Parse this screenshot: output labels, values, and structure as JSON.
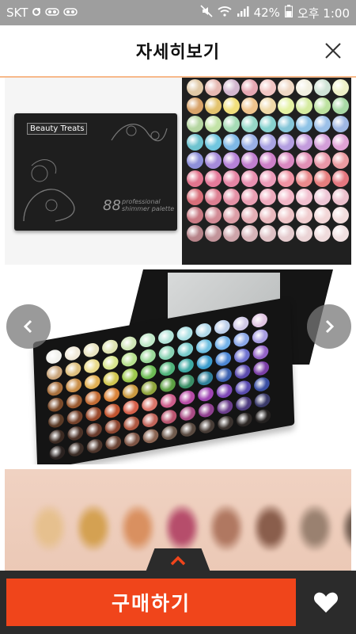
{
  "status_bar": {
    "carrier": "SKT",
    "battery": "42%",
    "time": "오후 1:00"
  },
  "header": {
    "title": "자세히보기"
  },
  "product": {
    "brand": "Beauty Treats",
    "number": "88",
    "subtitle_line1": "professional",
    "subtitle_line2": "shimmer palette"
  },
  "bottom": {
    "buy_label": "구매하기"
  },
  "colors": {
    "accent": "#f0451b",
    "bar": "#2b2b2b"
  },
  "palette_colors": [
    "#e0c9a6",
    "#e6b9b2",
    "#d3b7cf",
    "#e6a7b2",
    "#f1c5c3",
    "#efd8c4",
    "#f2f0e0",
    "#cfe3d6",
    "#eef0c8",
    "#d8a36a",
    "#e3c36e",
    "#f1df7c",
    "#f0c48d",
    "#efd9a8",
    "#e4f2a3",
    "#d5eba0",
    "#bde2a0",
    "#a9d9a6",
    "#b6d6a2",
    "#c3e3a7",
    "#a6dcb6",
    "#95d7c7",
    "#87d2cf",
    "#86c6d8",
    "#8fc3e6",
    "#9cc0e8",
    "#9fb7e2",
    "#6ec3cf",
    "#71c6df",
    "#7fb8e6",
    "#9ab0e6",
    "#a9a3e2",
    "#b39ee0",
    "#c39bdc",
    "#d39ed8",
    "#e0a2d6",
    "#8d8fd9",
    "#a58bd9",
    "#b582d7",
    "#c07fcf",
    "#cd7fc7",
    "#d987c0",
    "#e18fb5",
    "#e897a8",
    "#eb9ca1",
    "#e2758e",
    "#e47a9a",
    "#e585a5",
    "#e890b0",
    "#ec9bb8",
    "#ef93a3",
    "#e98a8c",
    "#e67e7e",
    "#e4777f",
    "#d86f7a",
    "#dd7f92",
    "#e491a6",
    "#ea9fb3",
    "#efaabd",
    "#f2b6c6",
    "#f1c0cf",
    "#eec7d6",
    "#ecc0cc",
    "#c97a84",
    "#d28b96",
    "#db9da6",
    "#e4aeb5",
    "#e9b9be",
    "#eec4c7",
    "#f0cdcf",
    "#f2d6d7",
    "#f3dddd",
    "#b7848a",
    "#c2949a",
    "#cda4aa",
    "#d6b3b8",
    "#dec0c4",
    "#e5cbce",
    "#ebd4d6",
    "#efdbdc",
    "#f1e0e1"
  ],
  "tray_colors": [
    "#f2f2ee",
    "#f0e9d9",
    "#e9e4c1",
    "#dfe3b1",
    "#cfe6b6",
    "#bfe7c7",
    "#b2e3d8",
    "#ace0e4",
    "#b0d8ea",
    "#bdcfe9",
    "#cfc8e6",
    "#e0c5e2",
    "#c9a57a",
    "#dfc07e",
    "#eadb8c",
    "#d8e58e",
    "#b7e08e",
    "#9bd89a",
    "#8ad2b4",
    "#79cacb",
    "#6fbfe0",
    "#74b2e8",
    "#8aa7e7",
    "#a79de0",
    "#a86f3c",
    "#c98e48",
    "#e2b054",
    "#d0c64f",
    "#9dc84c",
    "#6dbc54",
    "#4fb27a",
    "#3ea9a4",
    "#3b9ccc",
    "#4c86d4",
    "#6f72cf",
    "#9363c6",
    "#7a4a2a",
    "#9a5a30",
    "#c46c34",
    "#d9833a",
    "#c9993f",
    "#8fa43c",
    "#5c9e43",
    "#3a8e66",
    "#2f7f99",
    "#3d62b0",
    "#5b4bad",
    "#7a3ea6",
    "#5a3a26",
    "#74412a",
    "#9a4a2c",
    "#c0532f",
    "#d6604a",
    "#d9756a",
    "#cc5d8a",
    "#b64aa4",
    "#9f44b3",
    "#7e48b7",
    "#5a4cb0",
    "#3b4fa3",
    "#3b2a22",
    "#4c3227",
    "#6a3b2c",
    "#8c4530",
    "#ad5640",
    "#c0645a",
    "#b9546e",
    "#a84a84",
    "#8e3f8e",
    "#6b3e8c",
    "#4e3c80",
    "#3a3a6a",
    "#2a2220",
    "#3a2c26",
    "#4e362c",
    "#6a4434",
    "#7d5444",
    "#8a6452",
    "#6f5a4c",
    "#594a40",
    "#473c36",
    "#3a322e",
    "#2d2826",
    "#242120"
  ],
  "swatch_colors": [
    "#e6c08e",
    "#d4a152",
    "#d99060",
    "#b64d6b",
    "#b07861",
    "#8a5e4c",
    "#9a8170",
    "#6e5a4e"
  ]
}
